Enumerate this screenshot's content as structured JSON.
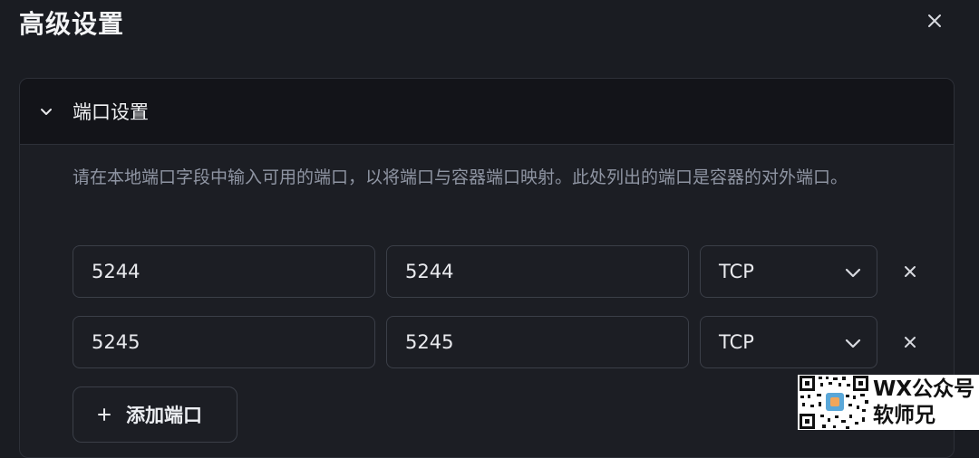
{
  "dialog": {
    "title": "高级设置",
    "close_icon": "close-icon"
  },
  "section": {
    "title": "端口设置",
    "expanded": true,
    "chevron_icon": "chevron-down-icon",
    "description": "请在本地端口字段中输入可用的端口，以将端口与容器端口映射。此处列出的端口是容器的对外端口。"
  },
  "ports": [
    {
      "local": "5244",
      "container": "5244",
      "protocol": "TCP"
    },
    {
      "local": "5245",
      "container": "5245",
      "protocol": "TCP"
    }
  ],
  "add_button": {
    "icon": "plus-icon",
    "label": "添加端口"
  },
  "watermark": {
    "line1": "WX公众号",
    "line2": "软师兄"
  },
  "colors": {
    "background": "#1a1c22",
    "panel_header": "#131419",
    "border": "#3b3f48",
    "text": "#e8e9ec",
    "muted_text": "#8f95a3"
  }
}
